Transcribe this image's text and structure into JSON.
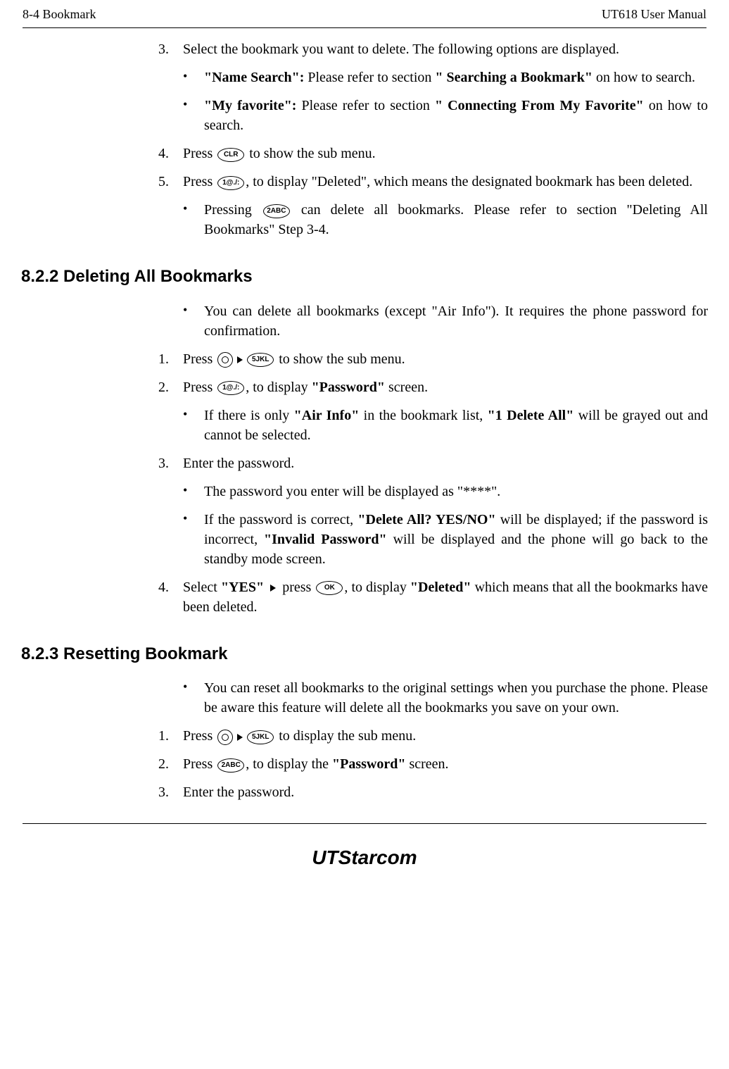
{
  "header": {
    "left": "8-4    Bookmark",
    "right": "UT618 User Manual"
  },
  "content": {
    "item3": {
      "num": "3.",
      "text_a": "Select the bookmark you want to delete. The following options are displayed."
    },
    "item3_bullet1": {
      "bold1": "\"Name Search\":",
      "text1": " Please refer to section ",
      "bold2": "\" Searching a Bookmark\"",
      "text2": " on how to search."
    },
    "item3_bullet2": {
      "bold1": "\"My favorite\":",
      "text1": " Please refer to section ",
      "bold2": "\" Connecting From My Favorite\"",
      "text2": " on how to search."
    },
    "item4": {
      "num": "4.",
      "text_a": "Press ",
      "icon1": "CLR",
      "text_b": " to show the sub menu."
    },
    "item5": {
      "num": "5.",
      "text_a": "Press ",
      "icon1": "1@./:",
      "text_b": ", to display \"Deleted\", which means the designated bookmark has been deleted."
    },
    "item5_bullet1": {
      "text_a": "Pressing ",
      "icon1": "2ABC",
      "text_b": " can delete all bookmarks. Please refer to section \"Deleting All Bookmarks\" Step 3-4."
    },
    "section822": "8.2.2 Deleting All Bookmarks",
    "s822_bullet1": {
      "text": "You can delete all bookmarks (except \"Air Info\"). It requires the phone password for confirmation."
    },
    "s822_item1": {
      "num": "1.",
      "text_a": "Press ",
      "icon2": "5JKL",
      "text_b": " to show the sub menu."
    },
    "s822_item2": {
      "num": "2.",
      "text_a": "Press ",
      "icon1": "1@./:",
      "text_b": ", to display ",
      "bold1": "\"Password\"",
      "text_c": " screen."
    },
    "s822_item2_bullet1": {
      "text_a": "If there is only ",
      "bold1": "\"Air Info\"",
      "text_b": " in the bookmark list, ",
      "bold2": "\"1 Delete All\"",
      "text_c": " will be grayed out and cannot be selected."
    },
    "s822_item3": {
      "num": "3.",
      "text": "Enter the password."
    },
    "s822_item3_bullet1": {
      "text": "The password you enter will be displayed as \"****\"."
    },
    "s822_item3_bullet2": {
      "text_a": "If the password is correct, ",
      "bold1": "\"Delete All? YES/NO\"",
      "text_b": " will be displayed; if the password is incorrect, ",
      "bold2": "\"Invalid Password\"",
      "text_c": " will be displayed and the phone will go back to the standby mode screen."
    },
    "s822_item4": {
      "num": "4.",
      "text_a": "Select ",
      "bold1": "\"YES\"",
      "text_b": " press ",
      "icon1": "OK",
      "text_c": ", to display ",
      "bold2": "\"Deleted\"",
      "text_d": " which means that all the bookmarks have been deleted."
    },
    "section823": "8.2.3 Resetting Bookmark",
    "s823_bullet1": {
      "text": "You can reset all bookmarks to the original settings when you purchase the phone. Please be aware this feature will delete all the bookmarks you save on your own."
    },
    "s823_item1": {
      "num": "1.",
      "text_a": "Press ",
      "icon2": "5JKL",
      "text_b": " to display the sub menu."
    },
    "s823_item2": {
      "num": "2.",
      "text_a": "Press ",
      "icon1": "2ABC",
      "text_b": ", to display the ",
      "bold1": "\"Password\"",
      "text_c": " screen."
    },
    "s823_item3": {
      "num": "3.",
      "text": "Enter the password."
    }
  },
  "logo": {
    "main": "UTStarcom"
  }
}
